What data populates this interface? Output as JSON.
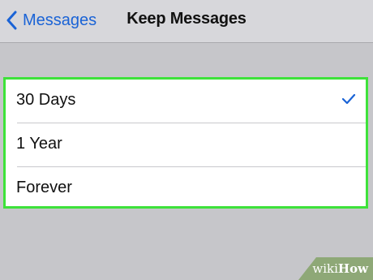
{
  "navbar": {
    "back_label": "Messages",
    "title": "Keep Messages"
  },
  "options": [
    {
      "label": "30 Days",
      "selected": true
    },
    {
      "label": "1 Year",
      "selected": false
    },
    {
      "label": "Forever",
      "selected": false
    }
  ],
  "watermark": {
    "prefix": "wiki",
    "suffix": "How"
  },
  "colors": {
    "accent": "#1a63d6",
    "highlight_border": "#3ee23a",
    "background": "#c6c6ca",
    "navbar": "#d7d7db"
  },
  "icons": {
    "back": "chevron-left-icon",
    "selected": "checkmark-icon"
  }
}
